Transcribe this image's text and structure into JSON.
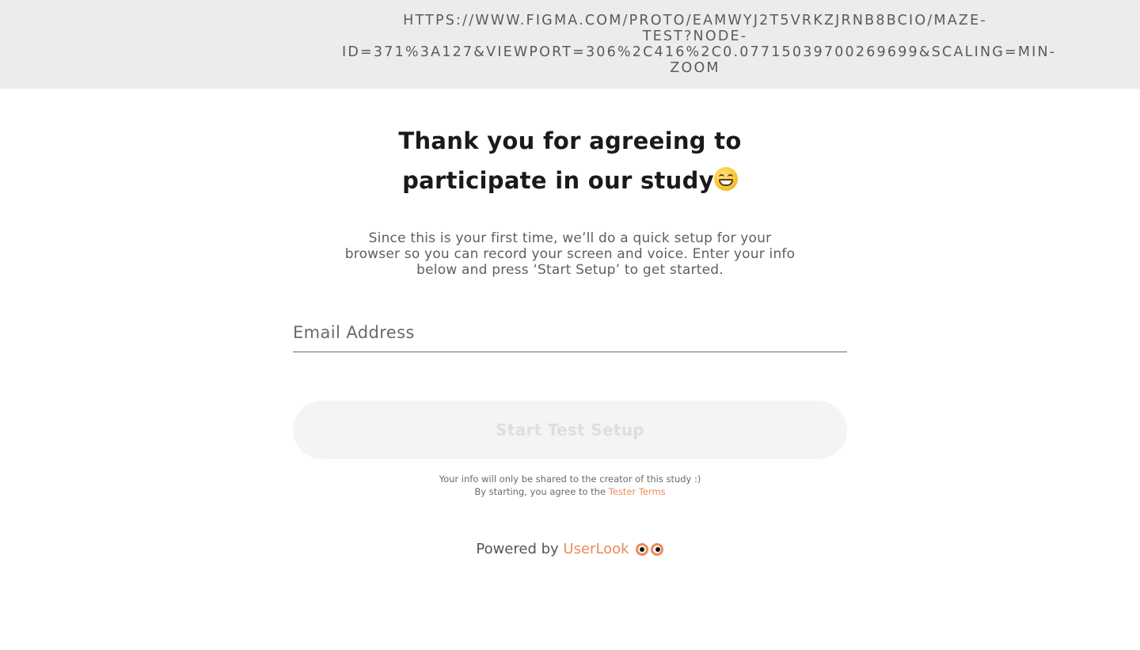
{
  "address_bar": {
    "url_lines": [
      "HTTPS://WWW.FIGMA.COM/PROTO/EAMWYJ2T5VRKZJRNB8BCIO/MAZE-",
      "TEST?NODE-",
      "ID=371%3A127&VIEWPORT=306%2C416%2C0.07715039700269699&SCALING=MIN-",
      "ZOOM"
    ]
  },
  "header": {
    "title_line1": "Thank you for agreeing to",
    "title_line2": "participate in our study",
    "title_emoji": "grinning-face-icon"
  },
  "intro": {
    "text": "Since this is your first time, we’ll do a quick setup for your browser so you can record your screen and voice. Enter your info below and press ‘Start Setup’ to get started."
  },
  "form": {
    "email_placeholder": "Email Address",
    "email_value": "",
    "start_button_label": "Start Test Setup"
  },
  "notice": {
    "privacy_text": "Your info will only be shared to the creator of this study :)",
    "terms_prefix": "By starting, you agree to the ",
    "terms_link": "Tester Terms"
  },
  "footer": {
    "powered_prefix": "Powered by ",
    "brand_name": "UserLook",
    "brand_icon": "eyes-icon"
  },
  "colors": {
    "accent": "#ef8a5a",
    "topbar_bg": "#ececec",
    "button_bg": "#f4f4f4",
    "button_text": "#dedede"
  }
}
